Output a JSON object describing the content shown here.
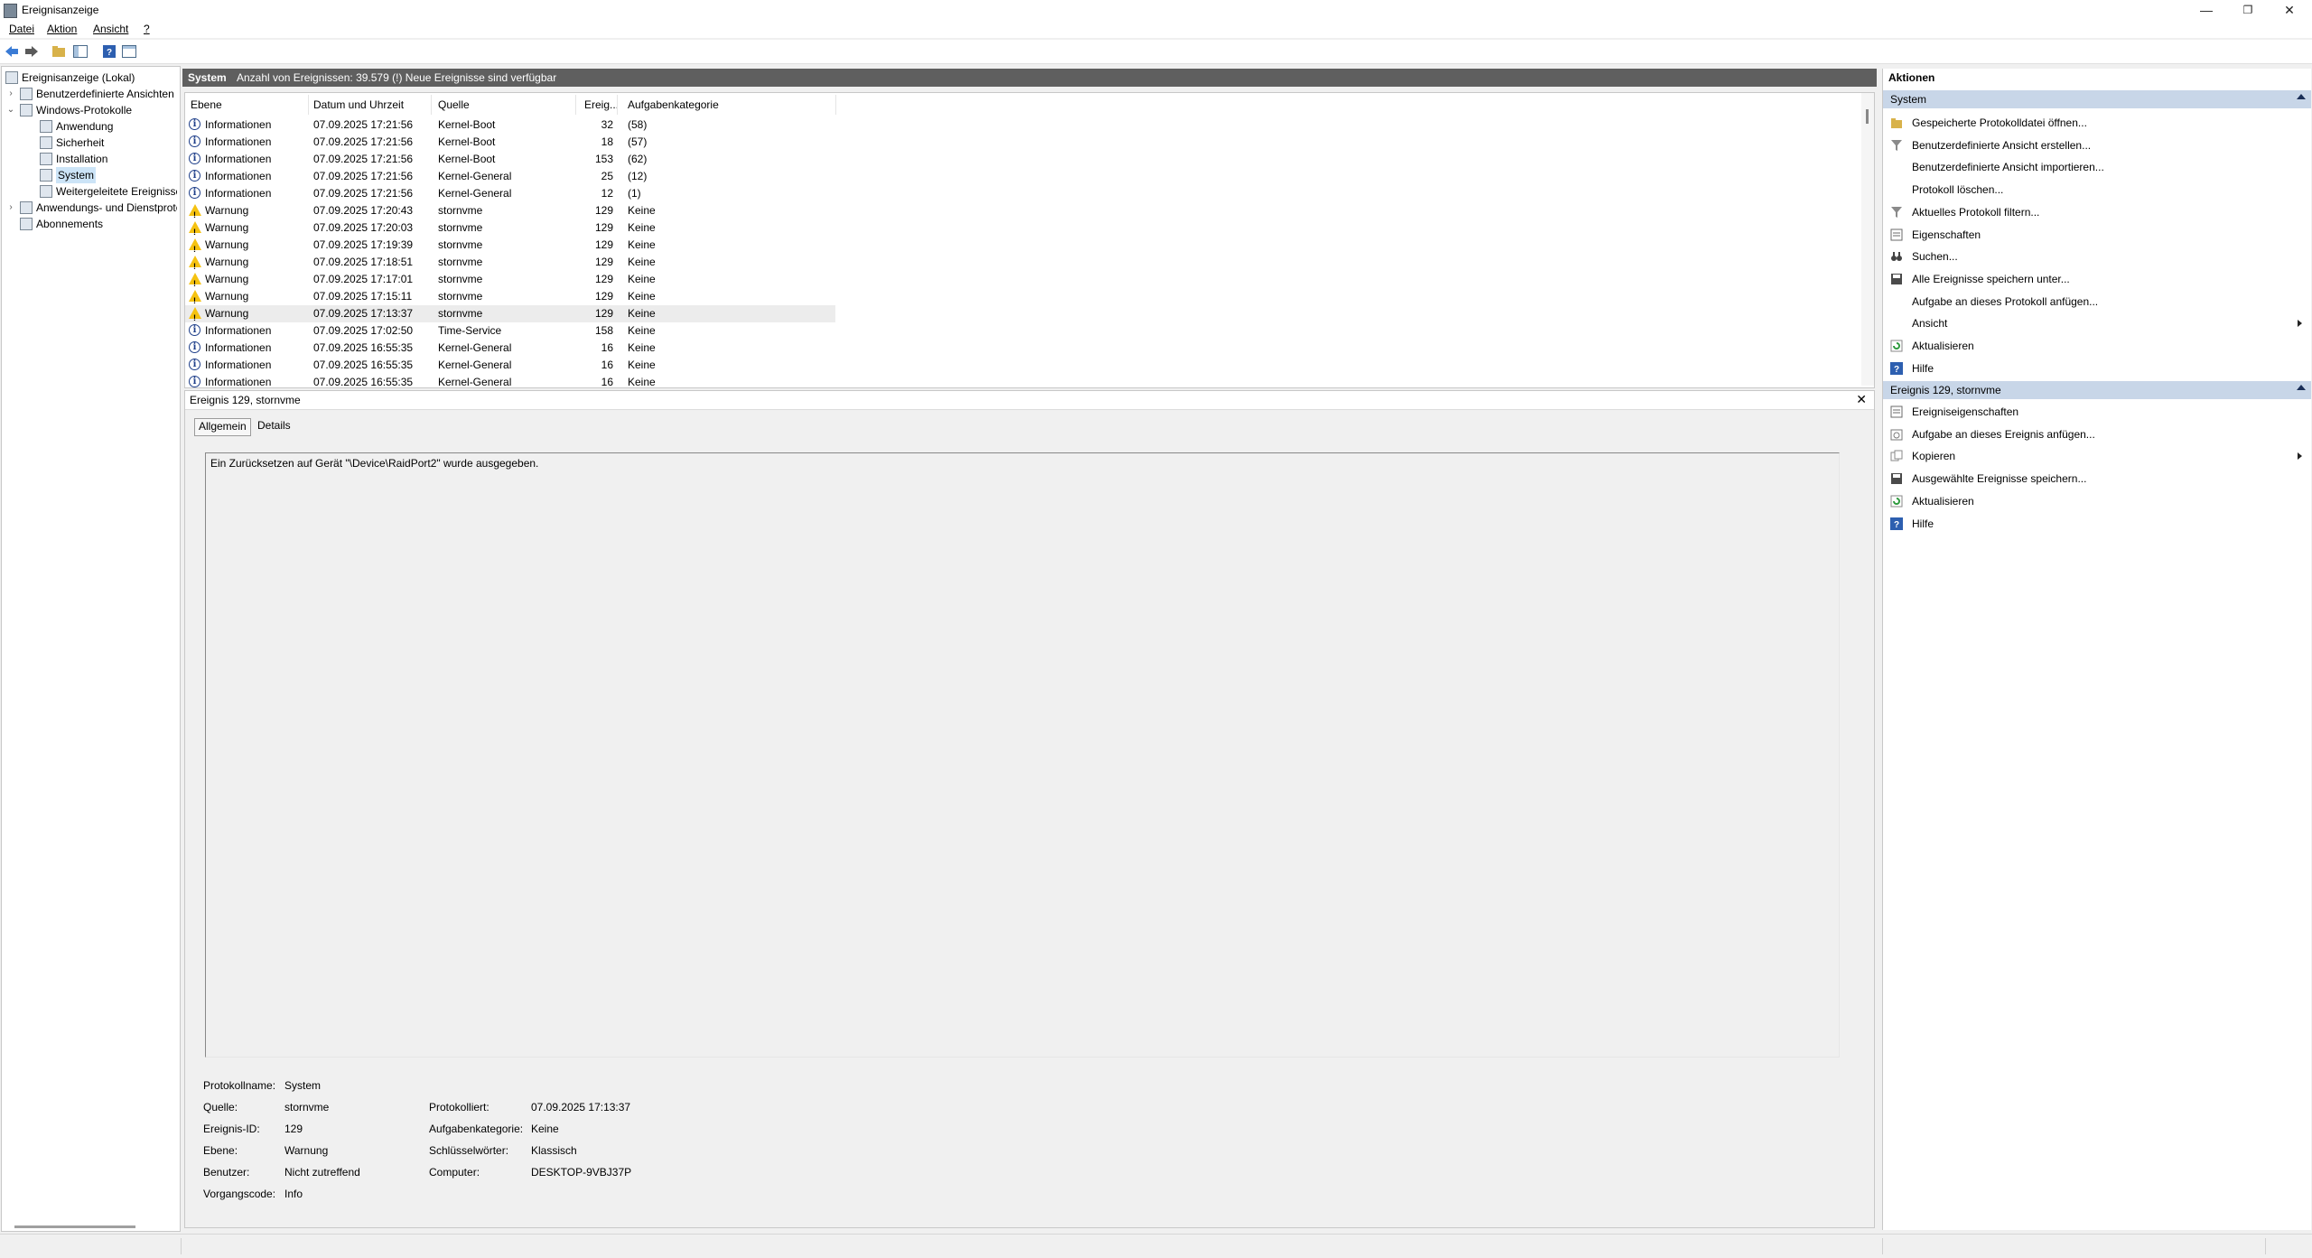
{
  "window": {
    "title": "Ereignisanzeige",
    "minimize": "—",
    "maximize": "❐",
    "close": "✕"
  },
  "menu": [
    "Datei",
    "Aktion",
    "Ansicht",
    "?"
  ],
  "tree": {
    "root": "Ereignisanzeige (Lokal)",
    "items": [
      {
        "label": "Benutzerdefinierte Ansichten",
        "level": 1
      },
      {
        "label": "Windows-Protokolle",
        "level": 1
      },
      {
        "label": "Anwendung",
        "level": 2
      },
      {
        "label": "Sicherheit",
        "level": 2
      },
      {
        "label": "Installation",
        "level": 2
      },
      {
        "label": "System",
        "level": 2,
        "selected": true
      },
      {
        "label": "Weitergeleitete Ereignisse",
        "level": 2
      },
      {
        "label": "Anwendungs- und Dienstprotokolle",
        "level": 1
      },
      {
        "label": "Abonnements",
        "level": 1
      }
    ]
  },
  "middle_header": {
    "log": "System",
    "info": "Anzahl von Ereignissen: 39.579 (!) Neue Ereignisse sind verfügbar"
  },
  "events": {
    "columns": [
      "Ebene",
      "Datum und Uhrzeit",
      "Quelle",
      "Ereig...",
      "Aufgabenkategorie"
    ],
    "rows": [
      {
        "level": "Informationen",
        "type": "info",
        "date": "07.09.2025 17:21:56",
        "source": "Kernel-Boot",
        "id": "32",
        "category": "(58)"
      },
      {
        "level": "Informationen",
        "type": "info",
        "date": "07.09.2025 17:21:56",
        "source": "Kernel-Boot",
        "id": "18",
        "category": "(57)"
      },
      {
        "level": "Informationen",
        "type": "info",
        "date": "07.09.2025 17:21:56",
        "source": "Kernel-Boot",
        "id": "153",
        "category": "(62)"
      },
      {
        "level": "Informationen",
        "type": "info",
        "date": "07.09.2025 17:21:56",
        "source": "Kernel-General",
        "id": "25",
        "category": "(12)"
      },
      {
        "level": "Informationen",
        "type": "info",
        "date": "07.09.2025 17:21:56",
        "source": "Kernel-General",
        "id": "12",
        "category": "(1)"
      },
      {
        "level": "Warnung",
        "type": "warn",
        "date": "07.09.2025 17:20:43",
        "source": "stornvme",
        "id": "129",
        "category": "Keine"
      },
      {
        "level": "Warnung",
        "type": "warn",
        "date": "07.09.2025 17:20:03",
        "source": "stornvme",
        "id": "129",
        "category": "Keine"
      },
      {
        "level": "Warnung",
        "type": "warn",
        "date": "07.09.2025 17:19:39",
        "source": "stornvme",
        "id": "129",
        "category": "Keine"
      },
      {
        "level": "Warnung",
        "type": "warn",
        "date": "07.09.2025 17:18:51",
        "source": "stornvme",
        "id": "129",
        "category": "Keine"
      },
      {
        "level": "Warnung",
        "type": "warn",
        "date": "07.09.2025 17:17:01",
        "source": "stornvme",
        "id": "129",
        "category": "Keine"
      },
      {
        "level": "Warnung",
        "type": "warn",
        "date": "07.09.2025 17:15:11",
        "source": "stornvme",
        "id": "129",
        "category": "Keine"
      },
      {
        "level": "Warnung",
        "type": "warn",
        "date": "07.09.2025 17:13:37",
        "source": "stornvme",
        "id": "129",
        "category": "Keine",
        "selected": true
      },
      {
        "level": "Informationen",
        "type": "info",
        "date": "07.09.2025 17:02:50",
        "source": "Time-Service",
        "id": "158",
        "category": "Keine"
      },
      {
        "level": "Informationen",
        "type": "info",
        "date": "07.09.2025 16:55:35",
        "source": "Kernel-General",
        "id": "16",
        "category": "Keine"
      },
      {
        "level": "Informationen",
        "type": "info",
        "date": "07.09.2025 16:55:35",
        "source": "Kernel-General",
        "id": "16",
        "category": "Keine"
      },
      {
        "level": "Informationen",
        "type": "info",
        "date": "07.09.2025 16:55:35",
        "source": "Kernel-General",
        "id": "16",
        "category": "Keine"
      }
    ]
  },
  "detail": {
    "title": "Ereignis 129, stornvme",
    "close": "✕",
    "tabs": [
      "Allgemein",
      "Details"
    ],
    "message": "Ein Zurücksetzen auf Gerät \"\\Device\\RaidPort2\" wurde ausgegeben.",
    "fields": {
      "protokollname_label": "Protokollname:",
      "protokollname": "System",
      "quelle_label": "Quelle:",
      "quelle": "stornvme",
      "protokolliert_label": "Protokolliert:",
      "protokolliert": "07.09.2025 17:13:37",
      "ereignis_id_label": "Ereignis-ID:",
      "ereignis_id": "129",
      "aufgabenkategorie_label": "Aufgabenkategorie:",
      "aufgabenkategorie": "Keine",
      "ebene_label": "Ebene:",
      "ebene": "Warnung",
      "schluesselwoerter_label": "Schlüsselwörter:",
      "schluesselwoerter": "Klassisch",
      "benutzer_label": "Benutzer:",
      "benutzer": "Nicht zutreffend",
      "computer_label": "Computer:",
      "computer": "DESKTOP-9VBJ37P",
      "vorgangscode_label": "Vorgangscode:",
      "vorgangscode": "Info"
    }
  },
  "actions": {
    "title": "Aktionen",
    "section1": {
      "title": "System",
      "items": [
        {
          "label": "Gespeicherte Protokolldatei öffnen...",
          "icon": "folder-icon"
        },
        {
          "label": "Benutzerdefinierte Ansicht erstellen...",
          "icon": "filter-icon"
        },
        {
          "label": "Benutzerdefinierte Ansicht importieren...",
          "icon": ""
        },
        {
          "label": "Protokoll löschen...",
          "icon": ""
        },
        {
          "label": "Aktuelles Protokoll filtern...",
          "icon": "filter-icon"
        },
        {
          "label": "Eigenschaften",
          "icon": "properties-icon"
        },
        {
          "label": "Suchen...",
          "icon": "binoculars-icon"
        },
        {
          "label": "Alle Ereignisse speichern unter...",
          "icon": "save-icon"
        },
        {
          "label": "Aufgabe an dieses Protokoll anfügen...",
          "icon": ""
        },
        {
          "label": "Ansicht",
          "icon": "",
          "submenu": true
        },
        {
          "label": "Aktualisieren",
          "icon": "refresh-icon"
        },
        {
          "label": "Hilfe",
          "icon": "help-icon"
        }
      ]
    },
    "section2": {
      "title": "Ereignis 129, stornvme",
      "items": [
        {
          "label": "Ereigniseigenschaften",
          "icon": "properties-icon"
        },
        {
          "label": "Aufgabe an dieses Ereignis anfügen...",
          "icon": "task-icon"
        },
        {
          "label": "Kopieren",
          "icon": "copy-icon",
          "submenu": true
        },
        {
          "label": "Ausgewählte Ereignisse speichern...",
          "icon": "save-icon"
        },
        {
          "label": "Aktualisieren",
          "icon": "refresh-icon"
        },
        {
          "label": "Hilfe",
          "icon": "help-icon"
        }
      ]
    }
  },
  "colors": {
    "header_dark": "#5f5f5f",
    "section_blue": "#c8d6e8",
    "warn_yellow": "#f5c211",
    "info_blue": "#1f3f8a",
    "selection": "#cce4f7"
  }
}
